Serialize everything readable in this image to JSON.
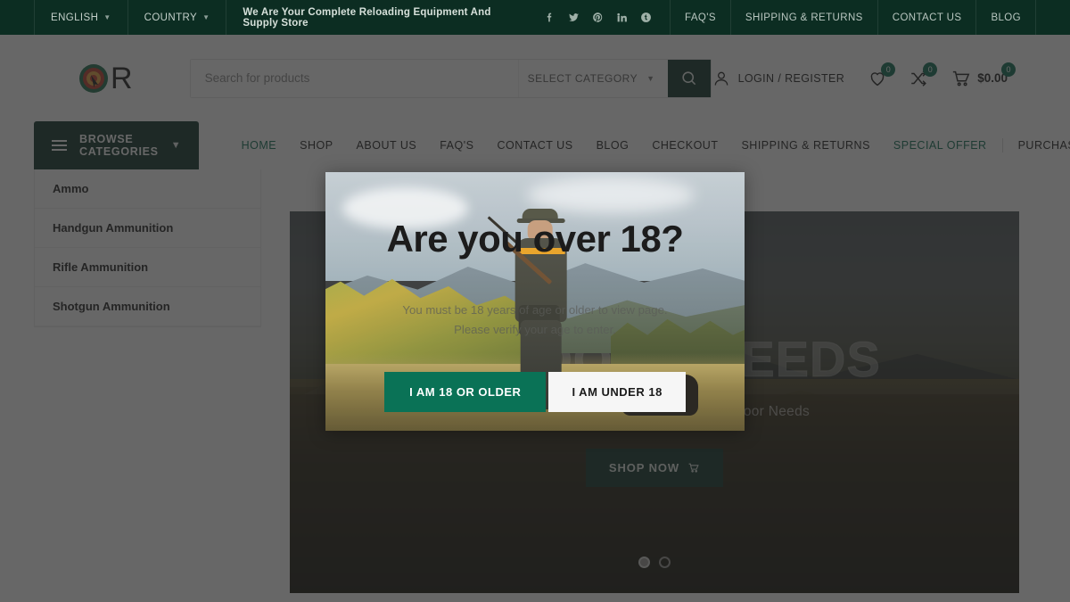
{
  "topbar": {
    "language": "ENGLISH",
    "country": "COUNTRY",
    "tagline": "We Are Your Complete Reloading Equipment And Supply Store",
    "socials": [
      "facebook-icon",
      "twitter-icon",
      "pinterest-icon",
      "linkedin-icon",
      "tumblr-icon"
    ],
    "links": [
      "FAQ'S",
      "SHIPPING & RETURNS",
      "CONTACT US",
      "BLOG"
    ]
  },
  "header": {
    "logo_text": "R",
    "search_placeholder": "Search for products",
    "category_label": "SELECT CATEGORY",
    "search_icon": "search-icon",
    "account_label": "LOGIN / REGISTER",
    "wishlist_count": "0",
    "compare_count": "0",
    "cart_count": "0",
    "cart_total": "$0.00"
  },
  "browse": {
    "label": "BROWSE CATEGORIES",
    "categories": [
      "Ammo",
      "Handgun Ammunition",
      "Rifle Ammunition",
      "Shotgun Ammunition"
    ]
  },
  "nav": {
    "items": [
      "HOME",
      "SHOP",
      "ABOUT US",
      "FAQ'S",
      "CONTACT US",
      "BLOG",
      "CHECKOUT",
      "SHIPPING & RETURNS"
    ],
    "active": "HOME",
    "right_items": [
      "SPECIAL OFFER",
      "PURCHASE THEME"
    ]
  },
  "hero": {
    "title": "OUTDOOR NEEDS",
    "subtitle": "Your One Stop Shop For All Your Outdoor Needs",
    "cta": "SHOP NOW",
    "cta_icon": "cart-icon",
    "slides": 2,
    "active_slide": 1
  },
  "modal": {
    "title": "Are you over 18?",
    "description": "You must be 18 years of age or older to view page. Please verify your age to enter.",
    "confirm_label": "I AM 18 OR OLDER",
    "deny_label": "I AM UNDER 18"
  },
  "colors": {
    "brand_dark_green": "#0c3127",
    "topbar_green": "#0c2d22",
    "accent_green": "#0d6b52",
    "modal_button_green": "#0a7256"
  }
}
